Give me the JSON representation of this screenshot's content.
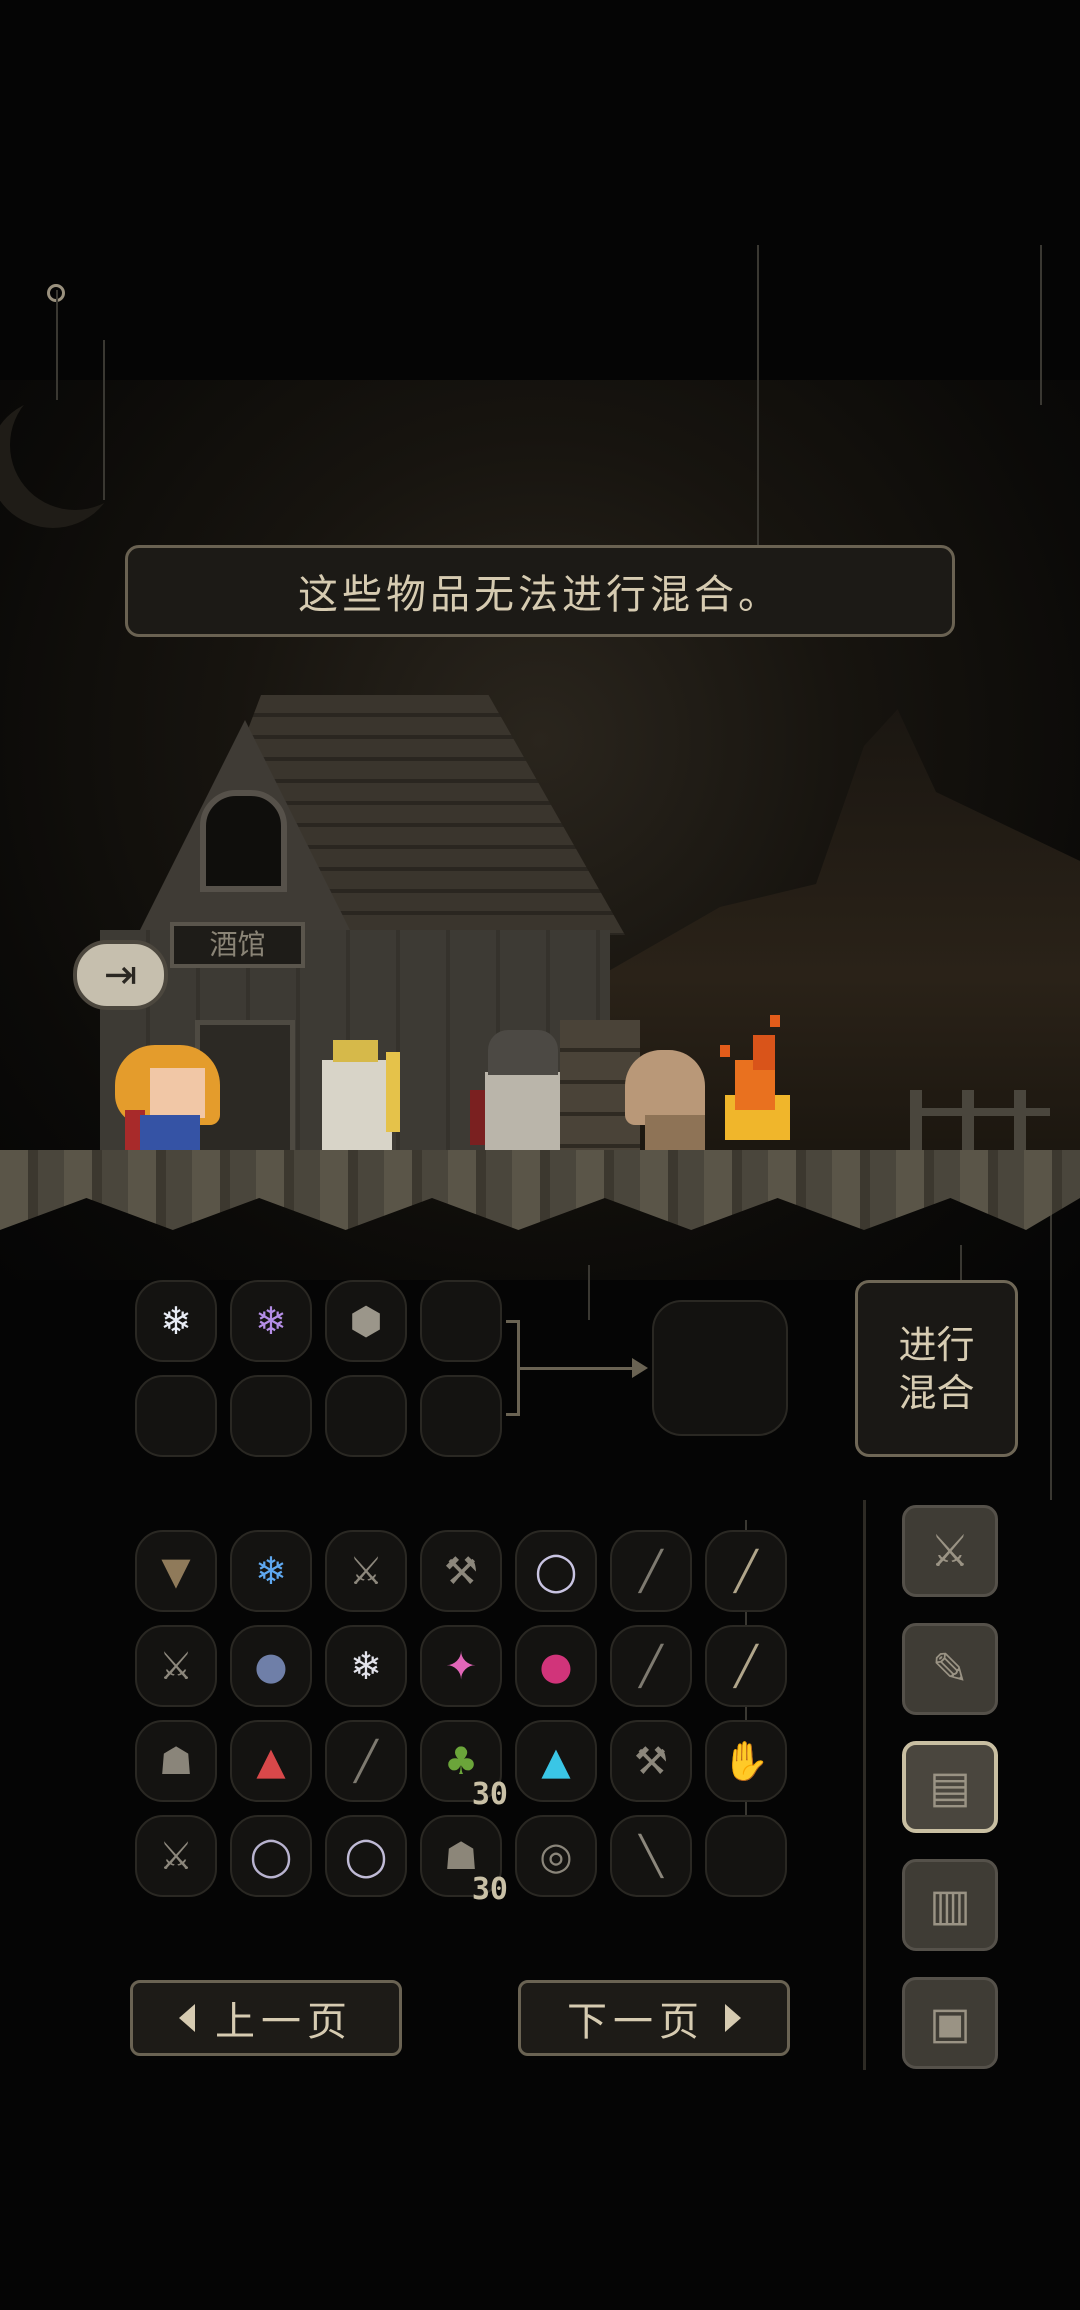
{
  "message": "这些物品无法进行混合。",
  "tavern_sign": "酒馆",
  "exit_icon": "exit-icon",
  "mix_button": "进行\n混合",
  "mix_slots": [
    {
      "icon": "white-crystal-icon",
      "glyph": "❄",
      "color": "#e8ecf5"
    },
    {
      "icon": "purple-crystal-icon",
      "glyph": "❄",
      "color": "#b58ee6"
    },
    {
      "icon": "ore-chunk-icon",
      "glyph": "⬢",
      "color": "#9b968a"
    },
    {
      "icon": "",
      "glyph": "",
      "color": ""
    },
    {
      "icon": "",
      "glyph": "",
      "color": ""
    },
    {
      "icon": "",
      "glyph": "",
      "color": ""
    },
    {
      "icon": "",
      "glyph": "",
      "color": ""
    },
    {
      "icon": "",
      "glyph": "",
      "color": ""
    }
  ],
  "inventory": [
    {
      "icon": "leather-armor-icon",
      "glyph": "▼",
      "color": "#8f7a5a",
      "qty": ""
    },
    {
      "icon": "blue-crystal-icon",
      "glyph": "❄",
      "color": "#5fa8f0",
      "qty": ""
    },
    {
      "icon": "pitchfork-icon",
      "glyph": "⚔",
      "color": "#8c877c",
      "qty": ""
    },
    {
      "icon": "axe-icon",
      "glyph": "⚒",
      "color": "#8c877c",
      "qty": ""
    },
    {
      "icon": "pearl-necklace-icon",
      "glyph": "◯",
      "color": "#c9c4e2",
      "qty": ""
    },
    {
      "icon": "sword-icon",
      "glyph": "╱",
      "color": "#7e7a70",
      "qty": ""
    },
    {
      "icon": "dagger-icon",
      "glyph": "╱",
      "color": "#b0a58a",
      "qty": ""
    },
    {
      "icon": "trident-icon",
      "glyph": "⚔",
      "color": "#8c877c",
      "qty": ""
    },
    {
      "icon": "dark-orbs-icon",
      "glyph": "●",
      "color": "#6f7fa8",
      "qty": ""
    },
    {
      "icon": "white-crystal-icon",
      "glyph": "❄",
      "color": "#e2e2ea",
      "qty": ""
    },
    {
      "icon": "rainbow-gems-icon",
      "glyph": "✦",
      "color": "#e266b8",
      "qty": ""
    },
    {
      "icon": "magenta-orbs-icon",
      "glyph": "●",
      "color": "#d1347a",
      "qty": ""
    },
    {
      "icon": "sword-icon",
      "glyph": "╱",
      "color": "#7e7a70",
      "qty": ""
    },
    {
      "icon": "dagger-icon",
      "glyph": "╱",
      "color": "#b0a58a",
      "qty": ""
    },
    {
      "icon": "skull-helm-icon",
      "glyph": "☗",
      "color": "#8a857a",
      "qty": ""
    },
    {
      "icon": "red-pyramid-icon",
      "glyph": "▲",
      "color": "#d8484a",
      "qty": ""
    },
    {
      "icon": "sword-icon",
      "glyph": "╱",
      "color": "#7e7a70",
      "qty": ""
    },
    {
      "icon": "green-potion-icon",
      "glyph": "♣",
      "color": "#6ba53a",
      "qty": "30"
    },
    {
      "icon": "cyan-pyramid-icon",
      "glyph": "▲",
      "color": "#3ac6e6",
      "qty": ""
    },
    {
      "icon": "halberd-icon",
      "glyph": "⚒",
      "color": "#8c877c",
      "qty": ""
    },
    {
      "icon": "gauntlet-icon",
      "glyph": "✋",
      "color": "#7a766c",
      "qty": ""
    },
    {
      "icon": "trident-icon",
      "glyph": "⚔",
      "color": "#8c877c",
      "qty": ""
    },
    {
      "icon": "silver-ring-icon",
      "glyph": "◯",
      "color": "#b8b3cf",
      "qty": ""
    },
    {
      "icon": "silver-ring-icon",
      "glyph": "◯",
      "color": "#c0bbd6",
      "qty": ""
    },
    {
      "icon": "hide-material-icon",
      "glyph": "☗",
      "color": "#8c8679",
      "qty": "30"
    },
    {
      "icon": "chain-amulet-icon",
      "glyph": "◎",
      "color": "#8a857a",
      "qty": ""
    },
    {
      "icon": "rifle-icon",
      "glyph": "╲",
      "color": "#8c877c",
      "qty": ""
    },
    {
      "icon": "",
      "glyph": "",
      "color": "",
      "qty": ""
    }
  ],
  "side_tabs": [
    {
      "icon": "crossed-swords-icon",
      "glyph": "⚔",
      "active": false
    },
    {
      "icon": "quill-scroll-icon",
      "glyph": "✎",
      "active": false
    },
    {
      "icon": "map-icon",
      "glyph": "▤",
      "active": true
    },
    {
      "icon": "documents-icon",
      "glyph": "▥",
      "active": false
    },
    {
      "icon": "computer-icon",
      "glyph": "▣",
      "active": false
    }
  ],
  "prev_page": "上一页",
  "next_page": "下一页",
  "colors": {
    "accent": "#6a6353",
    "text": "#d6cbb1",
    "fire": "#f0932b"
  }
}
